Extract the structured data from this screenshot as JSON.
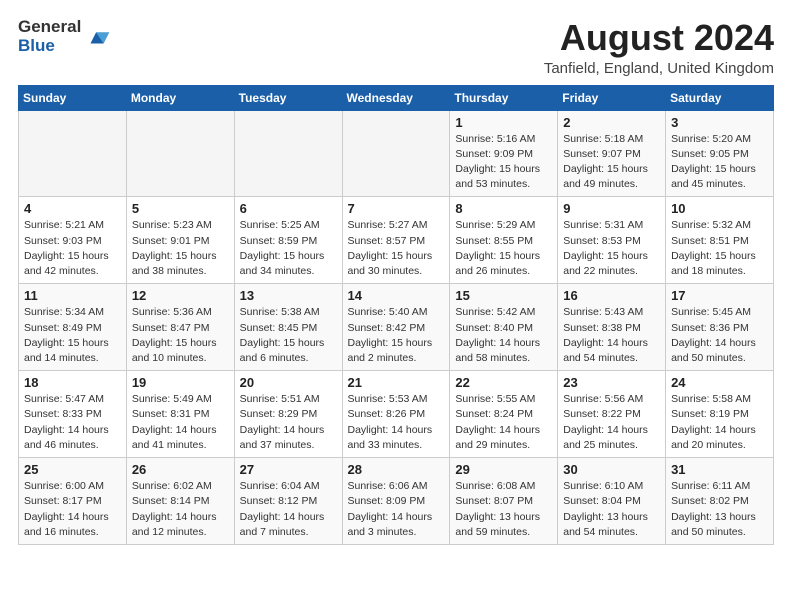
{
  "header": {
    "logo_general": "General",
    "logo_blue": "Blue",
    "month_title": "August 2024",
    "location": "Tanfield, England, United Kingdom"
  },
  "weekdays": [
    "Sunday",
    "Monday",
    "Tuesday",
    "Wednesday",
    "Thursday",
    "Friday",
    "Saturday"
  ],
  "weeks": [
    [
      {
        "day": "",
        "detail": ""
      },
      {
        "day": "",
        "detail": ""
      },
      {
        "day": "",
        "detail": ""
      },
      {
        "day": "",
        "detail": ""
      },
      {
        "day": "1",
        "detail": "Sunrise: 5:16 AM\nSunset: 9:09 PM\nDaylight: 15 hours\nand 53 minutes."
      },
      {
        "day": "2",
        "detail": "Sunrise: 5:18 AM\nSunset: 9:07 PM\nDaylight: 15 hours\nand 49 minutes."
      },
      {
        "day": "3",
        "detail": "Sunrise: 5:20 AM\nSunset: 9:05 PM\nDaylight: 15 hours\nand 45 minutes."
      }
    ],
    [
      {
        "day": "4",
        "detail": "Sunrise: 5:21 AM\nSunset: 9:03 PM\nDaylight: 15 hours\nand 42 minutes."
      },
      {
        "day": "5",
        "detail": "Sunrise: 5:23 AM\nSunset: 9:01 PM\nDaylight: 15 hours\nand 38 minutes."
      },
      {
        "day": "6",
        "detail": "Sunrise: 5:25 AM\nSunset: 8:59 PM\nDaylight: 15 hours\nand 34 minutes."
      },
      {
        "day": "7",
        "detail": "Sunrise: 5:27 AM\nSunset: 8:57 PM\nDaylight: 15 hours\nand 30 minutes."
      },
      {
        "day": "8",
        "detail": "Sunrise: 5:29 AM\nSunset: 8:55 PM\nDaylight: 15 hours\nand 26 minutes."
      },
      {
        "day": "9",
        "detail": "Sunrise: 5:31 AM\nSunset: 8:53 PM\nDaylight: 15 hours\nand 22 minutes."
      },
      {
        "day": "10",
        "detail": "Sunrise: 5:32 AM\nSunset: 8:51 PM\nDaylight: 15 hours\nand 18 minutes."
      }
    ],
    [
      {
        "day": "11",
        "detail": "Sunrise: 5:34 AM\nSunset: 8:49 PM\nDaylight: 15 hours\nand 14 minutes."
      },
      {
        "day": "12",
        "detail": "Sunrise: 5:36 AM\nSunset: 8:47 PM\nDaylight: 15 hours\nand 10 minutes."
      },
      {
        "day": "13",
        "detail": "Sunrise: 5:38 AM\nSunset: 8:45 PM\nDaylight: 15 hours\nand 6 minutes."
      },
      {
        "day": "14",
        "detail": "Sunrise: 5:40 AM\nSunset: 8:42 PM\nDaylight: 15 hours\nand 2 minutes."
      },
      {
        "day": "15",
        "detail": "Sunrise: 5:42 AM\nSunset: 8:40 PM\nDaylight: 14 hours\nand 58 minutes."
      },
      {
        "day": "16",
        "detail": "Sunrise: 5:43 AM\nSunset: 8:38 PM\nDaylight: 14 hours\nand 54 minutes."
      },
      {
        "day": "17",
        "detail": "Sunrise: 5:45 AM\nSunset: 8:36 PM\nDaylight: 14 hours\nand 50 minutes."
      }
    ],
    [
      {
        "day": "18",
        "detail": "Sunrise: 5:47 AM\nSunset: 8:33 PM\nDaylight: 14 hours\nand 46 minutes."
      },
      {
        "day": "19",
        "detail": "Sunrise: 5:49 AM\nSunset: 8:31 PM\nDaylight: 14 hours\nand 41 minutes."
      },
      {
        "day": "20",
        "detail": "Sunrise: 5:51 AM\nSunset: 8:29 PM\nDaylight: 14 hours\nand 37 minutes."
      },
      {
        "day": "21",
        "detail": "Sunrise: 5:53 AM\nSunset: 8:26 PM\nDaylight: 14 hours\nand 33 minutes."
      },
      {
        "day": "22",
        "detail": "Sunrise: 5:55 AM\nSunset: 8:24 PM\nDaylight: 14 hours\nand 29 minutes."
      },
      {
        "day": "23",
        "detail": "Sunrise: 5:56 AM\nSunset: 8:22 PM\nDaylight: 14 hours\nand 25 minutes."
      },
      {
        "day": "24",
        "detail": "Sunrise: 5:58 AM\nSunset: 8:19 PM\nDaylight: 14 hours\nand 20 minutes."
      }
    ],
    [
      {
        "day": "25",
        "detail": "Sunrise: 6:00 AM\nSunset: 8:17 PM\nDaylight: 14 hours\nand 16 minutes."
      },
      {
        "day": "26",
        "detail": "Sunrise: 6:02 AM\nSunset: 8:14 PM\nDaylight: 14 hours\nand 12 minutes."
      },
      {
        "day": "27",
        "detail": "Sunrise: 6:04 AM\nSunset: 8:12 PM\nDaylight: 14 hours\nand 7 minutes."
      },
      {
        "day": "28",
        "detail": "Sunrise: 6:06 AM\nSunset: 8:09 PM\nDaylight: 14 hours\nand 3 minutes."
      },
      {
        "day": "29",
        "detail": "Sunrise: 6:08 AM\nSunset: 8:07 PM\nDaylight: 13 hours\nand 59 minutes."
      },
      {
        "day": "30",
        "detail": "Sunrise: 6:10 AM\nSunset: 8:04 PM\nDaylight: 13 hours\nand 54 minutes."
      },
      {
        "day": "31",
        "detail": "Sunrise: 6:11 AM\nSunset: 8:02 PM\nDaylight: 13 hours\nand 50 minutes."
      }
    ]
  ]
}
